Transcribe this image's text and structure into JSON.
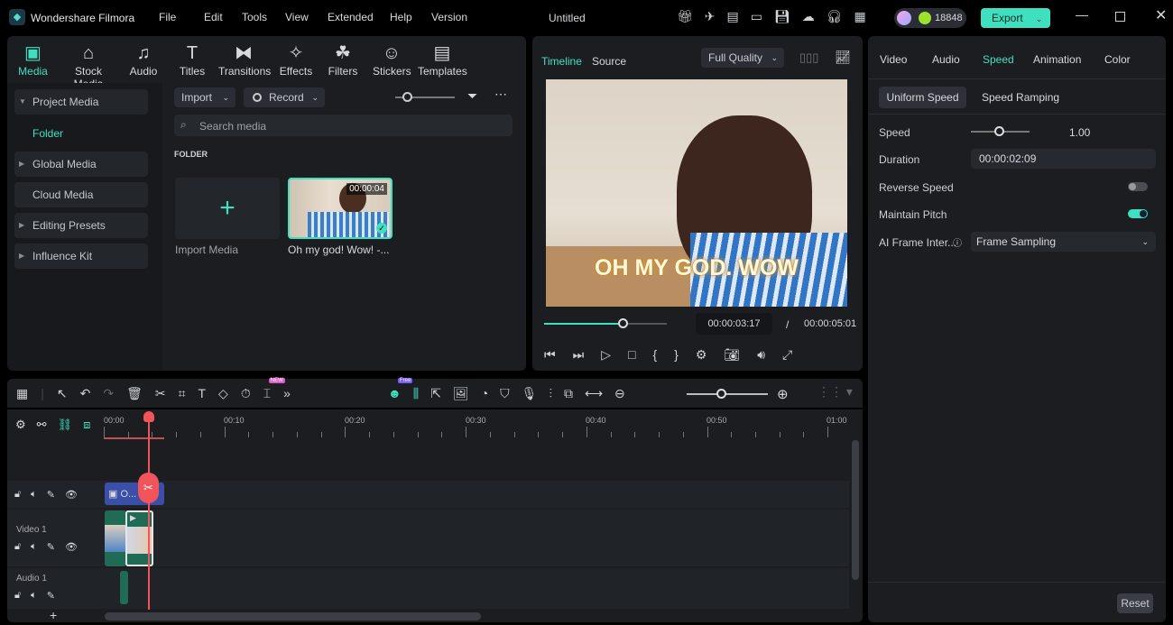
{
  "app": {
    "title": "Wondershare Filmora",
    "project": "Untitled",
    "credits": "18848",
    "export_label": "Export"
  },
  "menu": [
    "File",
    "Edit",
    "Tools",
    "View",
    "Extended",
    "Help",
    "Version"
  ],
  "media_tabs": [
    "Media",
    "Stock Media",
    "Audio",
    "Titles",
    "Transitions",
    "Effects",
    "Filters",
    "Stickers",
    "Templates"
  ],
  "sidebar": {
    "items": [
      "Project Media",
      "Folder",
      "Global Media",
      "Cloud Media",
      "Editing Presets",
      "Influence Kit"
    ]
  },
  "media": {
    "import_label": "Import",
    "record_label": "Record",
    "search_placeholder": "Search media",
    "folder_heading": "FOLDER",
    "import_media_label": "Import Media",
    "clip_name": "Oh my god! Wow! -...",
    "clip_duration": "00:00:04"
  },
  "player": {
    "tabs": [
      "Timeline",
      "Source"
    ],
    "quality": "Full Quality",
    "caption": "OH MY GOD. WOW",
    "current_time": "00:00:03:17",
    "separator": "/",
    "total_time": "00:00:05:01",
    "progress": 0.65
  },
  "properties": {
    "tabs": [
      "Video",
      "Audio",
      "Speed",
      "Animation",
      "Color"
    ],
    "active_tab": "Speed",
    "subtabs": [
      "Uniform Speed",
      "Speed Ramping"
    ],
    "speed_label": "Speed",
    "speed_value": "1.00",
    "duration_label": "Duration",
    "duration_value": "00:00:02:09",
    "reverse_label": "Reverse Speed",
    "reverse_on": false,
    "pitch_label": "Maintain Pitch",
    "pitch_on": true,
    "ai_label": "AI Frame Inter...",
    "ai_value": "Frame Sampling",
    "reset_label": "Reset"
  },
  "timeline": {
    "ruler": [
      "00:00",
      "00:10",
      "00:20",
      "00:30",
      "00:40",
      "00:50",
      "01:00"
    ],
    "tracks": [
      "Video 1",
      "Audio 1"
    ],
    "title_clip": "O...",
    "badge_new": "NEW",
    "badge_free": "Free"
  },
  "colors": {
    "accent": "#3fe0c0",
    "playhead": "#f2545b",
    "title_clip": "#3b4fa8",
    "video_clip": "#1f6b55"
  }
}
